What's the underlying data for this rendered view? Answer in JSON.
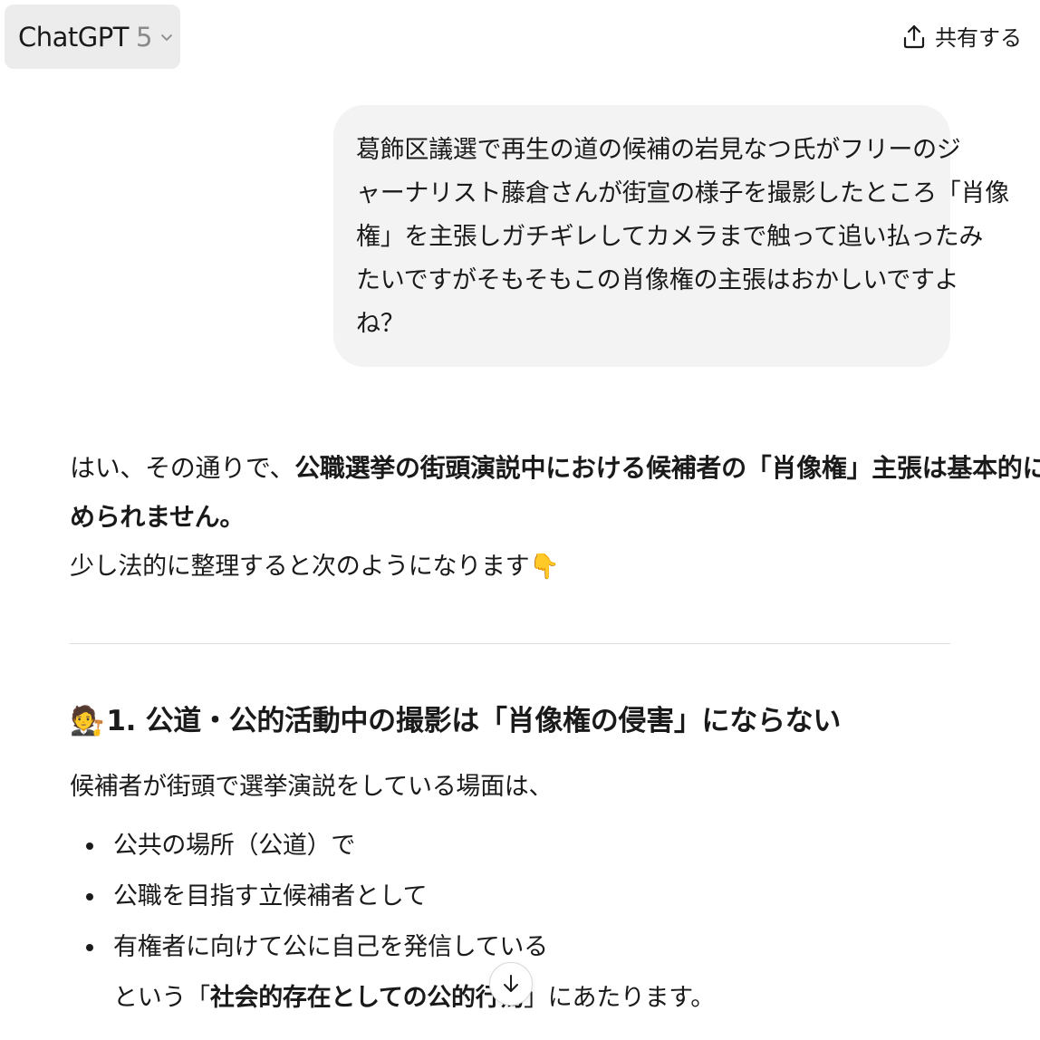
{
  "header": {
    "model_name": "ChatGPT",
    "model_version": "5",
    "share_label": "共有する"
  },
  "user_message": {
    "lines": [
      "葛飾区議選で再生の道の候補の岩見なつ氏がフリーのジ",
      "ャーナリスト藤倉さんが街宣の様子を撮影したところ「肖像",
      "権」を主張しガチギレしてカメラまで触って追い払ったみ",
      "たいですがそもそもこの肖像権の主張はおかしいですよ",
      "ね？"
    ]
  },
  "assistant": {
    "p1_normal": "はい、その通りで、",
    "p1_bold_a": "公職選挙の街頭演説中における候補者の「肖像権」主張は基本的に認",
    "p1_bold_b": "められません。",
    "p2": "少し法的に整理すると次のようになります👇",
    "heading_emoji": "🧑‍⚖️",
    "heading_text": "1. 公道・公的活動中の撮影は「肖像権の侵害」にならない",
    "intro": "候補者が街頭で選挙演説をしている場面は、",
    "bullets": [
      "公共の場所（公道）で",
      "公職を目指す立候補者として",
      "有権者に向けて公に自己を発信している"
    ],
    "cont_pre": "という「",
    "cont_bold": "社会的存在としての公的行為",
    "cont_post": "」にあたります。"
  },
  "icons": {
    "model_chevron": "chevron-down-icon",
    "share": "share-upload-icon",
    "scroll": "arrow-down-icon"
  }
}
